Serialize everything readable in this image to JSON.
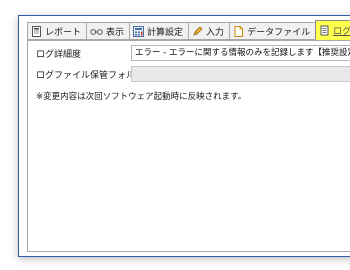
{
  "tabs": [
    {
      "label": "レポート",
      "icon": "report-icon"
    },
    {
      "label": "表示",
      "icon": "glasses-icon"
    },
    {
      "label": "計算設定",
      "icon": "calculator-icon"
    },
    {
      "label": "入力",
      "icon": "pencil-icon"
    },
    {
      "label": "データファイル",
      "icon": "data-file-icon"
    },
    {
      "label": "ログファ",
      "icon": "log-file-icon",
      "active": true
    }
  ],
  "settings": {
    "log_level_label": "ログ詳細度",
    "log_level_value": "エラー - エラーに関する情報のみを記録します【推奨設定】",
    "log_folder_label": "ログファイル保管フォルダ",
    "log_folder_value": "",
    "note": "※変更内容は次回ソフトウェア起動時に反映されます。"
  },
  "colors": {
    "active_tab_highlight": "#ffff4d",
    "window_border": "#2f5fa3"
  }
}
